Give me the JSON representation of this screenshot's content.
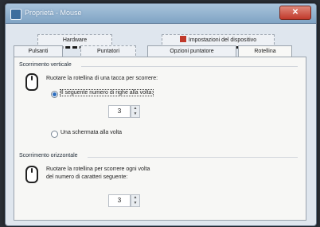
{
  "window": {
    "title": "Proprietà - Mouse",
    "close_symbol": "✕"
  },
  "tabs_back": [
    {
      "label": "Hardware"
    },
    {
      "label": "Impostazioni del dispositivo"
    }
  ],
  "tabs_front": [
    {
      "label": "Pulsanti"
    },
    {
      "label": "Puntatori"
    },
    {
      "label": "Opzioni puntatore"
    },
    {
      "label": "Rotellina"
    }
  ],
  "vertical": {
    "title": "Scorrimento verticale",
    "description": "Ruotare la rotellina di una tacca per scorrere:",
    "option_lines": "Il seguente numero di righe alla volta:",
    "lines_value": "3",
    "option_screen": "Una schermata alla volta"
  },
  "horizontal": {
    "title": "Scorrimento orizzontale",
    "description_line1": "Ruotare la rotellina per scorrere ogni volta",
    "description_line2": "del numero di caratteri seguente:",
    "chars_value": "3"
  },
  "icons": {
    "mouse": "mouse-icon",
    "shield": "shield-icon",
    "spin_up": "▲",
    "spin_down": "▼"
  }
}
